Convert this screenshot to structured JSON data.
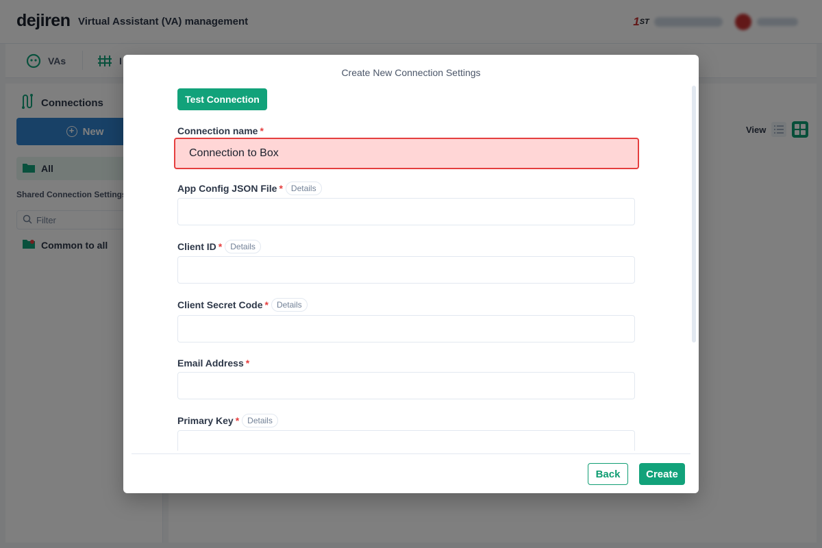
{
  "header": {
    "logo": "dejiren",
    "app_title": "Virtual Assistant (VA) management",
    "brand_badge": "ST"
  },
  "nav": {
    "items": [
      {
        "label": "VAs",
        "icon": "va-icon"
      },
      {
        "label": "I",
        "icon": "integration-icon"
      }
    ]
  },
  "sidebar": {
    "title": "Connections",
    "new_button": "New",
    "all_label": "All",
    "shared_title": "Shared Connection Settings",
    "filter_placeholder": "Filter",
    "common_label": "Common to all"
  },
  "main": {
    "view_label": "View"
  },
  "modal": {
    "title": "Create New Connection Settings",
    "test_button": "Test Connection",
    "details_label": "Details",
    "fields": [
      {
        "label": "Connection name",
        "value": "Connection to Box",
        "required": true,
        "details": false
      },
      {
        "label": "App Config JSON File",
        "value": "",
        "required": true,
        "details": true
      },
      {
        "label": "Client ID",
        "value": "",
        "required": true,
        "details": true
      },
      {
        "label": "Client Secret Code",
        "value": "",
        "required": true,
        "details": true
      },
      {
        "label": "Email Address",
        "value": "",
        "required": true,
        "details": false
      },
      {
        "label": "Primary Key",
        "value": "",
        "required": true,
        "details": true
      }
    ],
    "required_mark": "*",
    "back_button": "Back",
    "create_button": "Create"
  },
  "colors": {
    "accent": "#12a27a",
    "error": "#e53e3e",
    "error_bg": "#ffd6d6",
    "primary_blue": "#3182ce"
  }
}
